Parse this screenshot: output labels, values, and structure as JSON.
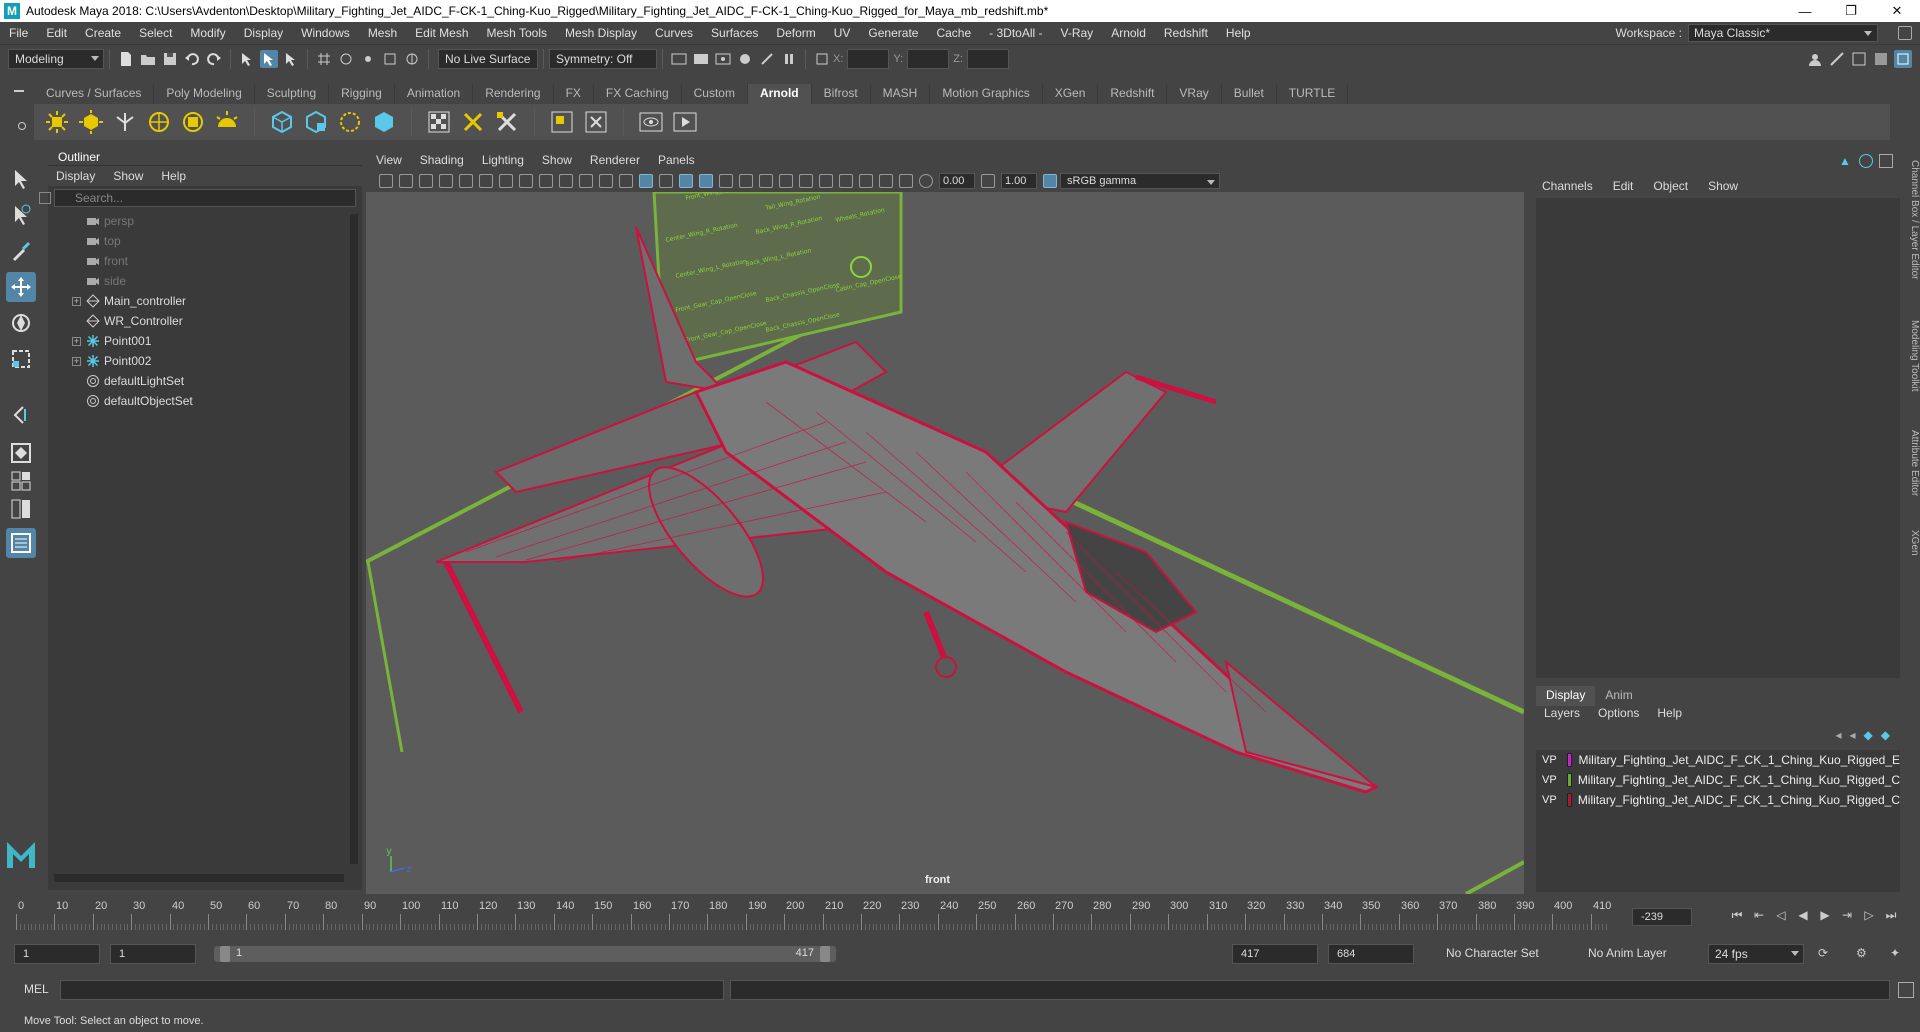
{
  "window": {
    "title": "Autodesk Maya 2018: C:\\Users\\Avdenton\\Desktop\\Military_Fighting_Jet_AIDC_F-CK-1_Ching-Kuo_Rigged\\Military_Fighting_Jet_AIDC_F-CK-1_Ching-Kuo_Rigged_for_Maya_mb_redshift.mb*",
    "logo": "M"
  },
  "menubar": {
    "items": [
      "File",
      "Edit",
      "Create",
      "Select",
      "Modify",
      "Display",
      "Windows",
      "Mesh",
      "Edit Mesh",
      "Mesh Tools",
      "Mesh Display",
      "Curves",
      "Surfaces",
      "Deform",
      "UV",
      "Generate",
      "Cache",
      "- 3DtoAll -",
      "V-Ray",
      "Arnold",
      "Redshift",
      "Help"
    ],
    "workspace_label": "Workspace :",
    "workspace_value": "Maya Classic*"
  },
  "statusline": {
    "mode": "Modeling",
    "live_surface": "No Live Surface",
    "symmetry": "Symmetry: Off",
    "x_label": "X:",
    "y_label": "Y:",
    "z_label": "Z:"
  },
  "shelf": {
    "tabs": [
      "Curves / Surfaces",
      "Poly Modeling",
      "Sculpting",
      "Rigging",
      "Animation",
      "Rendering",
      "FX",
      "FX Caching",
      "Custom",
      "Arnold",
      "Bifrost",
      "MASH",
      "Motion Graphics",
      "XGen",
      "Redshift",
      "VRay",
      "Bullet",
      "TURTLE"
    ],
    "active_tab": "Arnold"
  },
  "outliner": {
    "title": "Outliner",
    "menu": [
      "Display",
      "Show",
      "Help"
    ],
    "search_placeholder": "Search...",
    "items": [
      {
        "label": "persp",
        "icon": "camera-icon",
        "dim": true,
        "expandable": false
      },
      {
        "label": "top",
        "icon": "camera-icon",
        "dim": true,
        "expandable": false
      },
      {
        "label": "front",
        "icon": "camera-icon",
        "dim": true,
        "expandable": false
      },
      {
        "label": "side",
        "icon": "camera-icon",
        "dim": true,
        "expandable": false
      },
      {
        "label": "Main_controller",
        "icon": "transform-icon",
        "dim": false,
        "expandable": true
      },
      {
        "label": "WR_Controller",
        "icon": "transform-icon",
        "dim": false,
        "expandable": false
      },
      {
        "label": "Point001",
        "icon": "point-light-icon",
        "dim": false,
        "expandable": true
      },
      {
        "label": "Point002",
        "icon": "point-light-icon",
        "dim": false,
        "expandable": true
      },
      {
        "label": "defaultLightSet",
        "icon": "set-icon",
        "dim": false,
        "expandable": false
      },
      {
        "label": "defaultObjectSet",
        "icon": "set-icon",
        "dim": false,
        "expandable": false
      }
    ]
  },
  "viewport": {
    "menu": [
      "View",
      "Shading",
      "Lighting",
      "Show",
      "Renderer",
      "Panels"
    ],
    "exposure": "0.00",
    "gamma": "1.00",
    "color_space": "sRGB gamma",
    "camera_label": "front",
    "axis_y": "y",
    "axis_z": "z",
    "panel_texts": [
      "Front_Wing_R_Rotation",
      "Tail_Wing_Rotation",
      "Center_Wing_R_Rotation",
      "Back_Wing_R_Rotation",
      "Wheels_Rotation",
      "Center_Wing_L_Rotation",
      "Back_Wing_L_Rotation",
      "Front_Gear_Cap_OpenClose",
      "Back_Chassis_OpenClose",
      "Cabin_Cap_OpenClose",
      "Front_Gear_Cap_OpenClose",
      "Back_Chassis_OpenClose"
    ]
  },
  "channelbox": {
    "menu": [
      "Channels",
      "Edit",
      "Object",
      "Show"
    ],
    "layer_tabs": [
      "Display",
      "Anim"
    ],
    "active_layer_tab": "Display",
    "layer_menu": [
      "Layers",
      "Options",
      "Help"
    ],
    "layers": [
      {
        "v": "V",
        "p": "P",
        "color": "#cc22cc",
        "name": "Military_Fighting_Jet_AIDC_F_CK_1_Ching_Kuo_Rigged_E"
      },
      {
        "v": "V",
        "p": "P",
        "color": "#66aa33",
        "name": "Military_Fighting_Jet_AIDC_F_CK_1_Ching_Kuo_Rigged_C"
      },
      {
        "v": "V",
        "p": "P",
        "color": "#aa1a33",
        "name": "Military_Fighting_Jet_AIDC_F_CK_1_Ching_Kuo_Rigged_C"
      }
    ],
    "side_tabs": [
      "Channel Box / Layer Editor",
      "Modeling Toolkit",
      "Attribute Editor",
      "XGen"
    ]
  },
  "timeslider": {
    "ticks": [
      "0",
      "10",
      "20",
      "30",
      "40",
      "50",
      "60",
      "70",
      "80",
      "90",
      "100",
      "110",
      "120",
      "130",
      "140",
      "150",
      "160",
      "170",
      "180",
      "190",
      "200",
      "210",
      "220",
      "230",
      "240",
      "250",
      "260",
      "270",
      "280",
      "290",
      "300",
      "310",
      "320",
      "330",
      "340",
      "350",
      "360",
      "370",
      "380",
      "390",
      "400",
      "410"
    ],
    "current_frame": "-239"
  },
  "rangeslider": {
    "start": "1",
    "anim_start": "1",
    "range_start": "1",
    "range_end": "417",
    "anim_end": "417",
    "end": "684",
    "character_set": "No Character Set",
    "anim_layer": "No Anim Layer",
    "fps": "24 fps"
  },
  "cmdline": {
    "label": "MEL"
  },
  "helpline": {
    "text": "Move Tool: Select an object to move."
  }
}
